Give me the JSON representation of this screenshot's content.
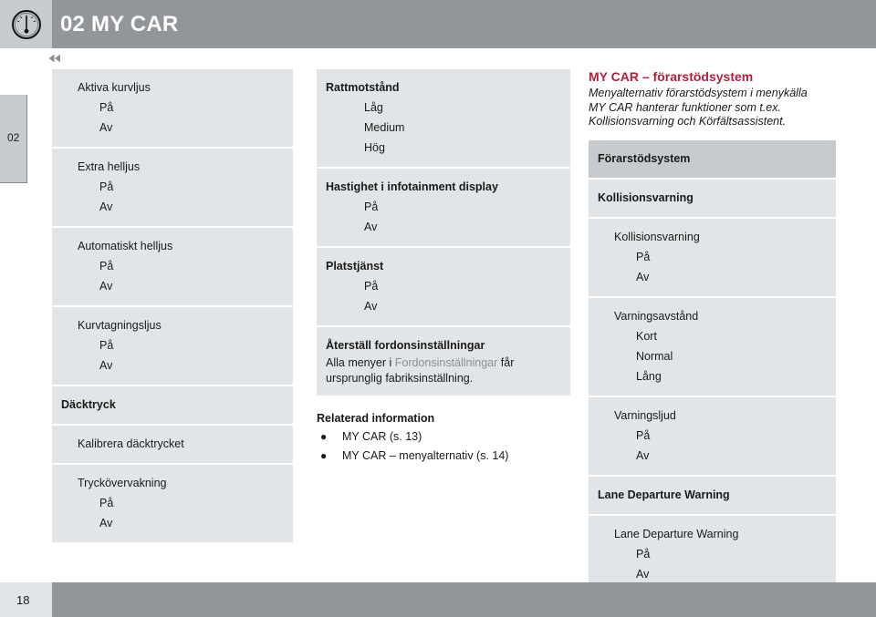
{
  "header": {
    "title": "02 MY CAR",
    "icon": "gauge-icon",
    "bar_color": "#939699",
    "icon_box_color": "#c8cbcd"
  },
  "chapter_tab": {
    "label": "02"
  },
  "nav": {
    "rewind_icon": "double-left-arrow-icon"
  },
  "columns": {
    "left": {
      "groups": [
        {
          "level": 2,
          "rows": [
            {
              "text": "Aktiva kurvljus",
              "indent": "lv1"
            },
            {
              "text": "På",
              "indent": "lv2"
            },
            {
              "text": "Av",
              "indent": "lv2"
            }
          ]
        },
        {
          "level": 2,
          "rows": [
            {
              "text": "Extra helljus",
              "indent": "lv1"
            },
            {
              "text": "På",
              "indent": "lv2"
            },
            {
              "text": "Av",
              "indent": "lv2"
            }
          ]
        },
        {
          "level": 2,
          "rows": [
            {
              "text": "Automatiskt helljus",
              "indent": "lv1"
            },
            {
              "text": "På",
              "indent": "lv2"
            },
            {
              "text": "Av",
              "indent": "lv2"
            }
          ]
        },
        {
          "level": 2,
          "rows": [
            {
              "text": "Kurvtagningsljus",
              "indent": "lv1"
            },
            {
              "text": "På",
              "indent": "lv2"
            },
            {
              "text": "Av",
              "indent": "lv2"
            }
          ]
        },
        {
          "level": 2,
          "rows": [
            {
              "text": "Däcktryck",
              "indent": "head"
            }
          ]
        },
        {
          "level": 2,
          "rows": [
            {
              "text": "Kalibrera däcktrycket",
              "indent": "lv1"
            }
          ]
        },
        {
          "level": 2,
          "rows": [
            {
              "text": "Tryckövervakning",
              "indent": "lv1"
            },
            {
              "text": "På",
              "indent": "lv2"
            },
            {
              "text": "Av",
              "indent": "lv2"
            }
          ]
        }
      ]
    },
    "middle": {
      "groups": [
        {
          "level": 2,
          "rows": [
            {
              "text": "Rattmotstånd",
              "indent": "head"
            },
            {
              "text": "Låg",
              "indent": "lv2"
            },
            {
              "text": "Medium",
              "indent": "lv2"
            },
            {
              "text": "Hög",
              "indent": "lv2"
            }
          ]
        },
        {
          "level": 2,
          "rows": [
            {
              "text": "Hastighet i infotainment display",
              "indent": "head"
            },
            {
              "text": "På",
              "indent": "lv2"
            },
            {
              "text": "Av",
              "indent": "lv2"
            }
          ]
        },
        {
          "level": 2,
          "rows": [
            {
              "text": "Platstjänst",
              "indent": "head"
            },
            {
              "text": "På",
              "indent": "lv2"
            },
            {
              "text": "Av",
              "indent": "lv2"
            }
          ]
        },
        {
          "level": 2,
          "rows": [
            {
              "text": "Återställ fordonsinställningar",
              "indent": "head"
            }
          ],
          "note": {
            "prefix": "Alla menyer i ",
            "ref": "Fordonsinställningar",
            "suffix": " får ursprunglig fabriksinställning."
          }
        }
      ],
      "related": {
        "title": "Relaterad information",
        "items": [
          "MY CAR (s. 13)",
          "MY CAR – menyalternativ (s. 14)"
        ]
      }
    },
    "right": {
      "intro": {
        "title": "MY CAR – förarstödsystem",
        "title_color": "#b0223a",
        "body": "Menyalternativ förarstödsystem i menykälla MY CAR hanterar funktioner som t.ex. Kollisionsvarning och Körfältsassistent."
      },
      "groups": [
        {
          "level": 1,
          "rows": [
            {
              "text": "Förarstödsystem",
              "indent": "head"
            }
          ]
        },
        {
          "level": 2,
          "rows": [
            {
              "text": "Kollisionsvarning",
              "indent": "head"
            }
          ]
        },
        {
          "level": 2,
          "rows": [
            {
              "text": "Kollisionsvarning",
              "indent": "lv1"
            },
            {
              "text": "På",
              "indent": "lv2"
            },
            {
              "text": "Av",
              "indent": "lv2"
            }
          ]
        },
        {
          "level": 2,
          "rows": [
            {
              "text": "Varningsavstånd",
              "indent": "lv1"
            },
            {
              "text": "Kort",
              "indent": "lv2"
            },
            {
              "text": "Normal",
              "indent": "lv2"
            },
            {
              "text": "Lång",
              "indent": "lv2"
            }
          ]
        },
        {
          "level": 2,
          "rows": [
            {
              "text": "Varningsljud",
              "indent": "lv1"
            },
            {
              "text": "På",
              "indent": "lv2"
            },
            {
              "text": "Av",
              "indent": "lv2"
            }
          ]
        },
        {
          "level": 2,
          "rows": [
            {
              "text": "Lane Departure Warning",
              "indent": "head"
            }
          ]
        },
        {
          "level": 2,
          "rows": [
            {
              "text": "Lane Departure Warning",
              "indent": "lv1"
            },
            {
              "text": "På",
              "indent": "lv2"
            },
            {
              "text": "Av",
              "indent": "lv2"
            }
          ]
        }
      ]
    }
  },
  "footer": {
    "page_number": "18",
    "bar_color": "#939699"
  }
}
